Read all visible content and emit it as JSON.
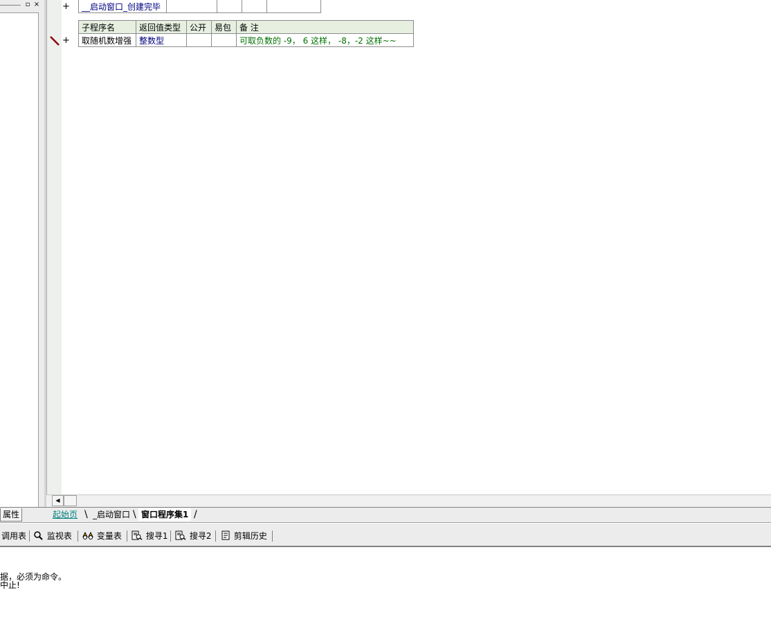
{
  "left_panel": {
    "restore_glyph": "▫",
    "close_glyph": "×",
    "bottom_tab_label": "属性"
  },
  "code": {
    "top_row": {
      "plus": "+",
      "name": "__启动窗口_创建完毕"
    },
    "subroutine_table": {
      "headers": [
        "子程序名",
        "返回值类型",
        "公开",
        "易包",
        "备 注"
      ],
      "row": {
        "plus": "+",
        "name": "取随机数增强",
        "return_type": "整数型",
        "public": "",
        "easy_pack": "",
        "remark": "可取负数的 -9， 6  这样， -8，-2 这样~~"
      }
    }
  },
  "tabs": [
    {
      "label": "起始页"
    },
    {
      "label": "_启动窗口"
    },
    {
      "label": "窗口程序集1"
    }
  ],
  "toolbar": {
    "items": [
      {
        "label": "调用表"
      },
      {
        "label": "监视表"
      },
      {
        "label": "变量表"
      },
      {
        "label": "搜寻1"
      },
      {
        "label": "搜寻2"
      },
      {
        "label": "剪辑历史"
      }
    ]
  },
  "output": {
    "lines": [
      "据，必须为命令。",
      "中止!"
    ]
  },
  "colors": {
    "header_bg": "#e6efe0",
    "type_blue": "#000080",
    "remark_green": "#007000",
    "active_tab_teal": "#008080"
  }
}
